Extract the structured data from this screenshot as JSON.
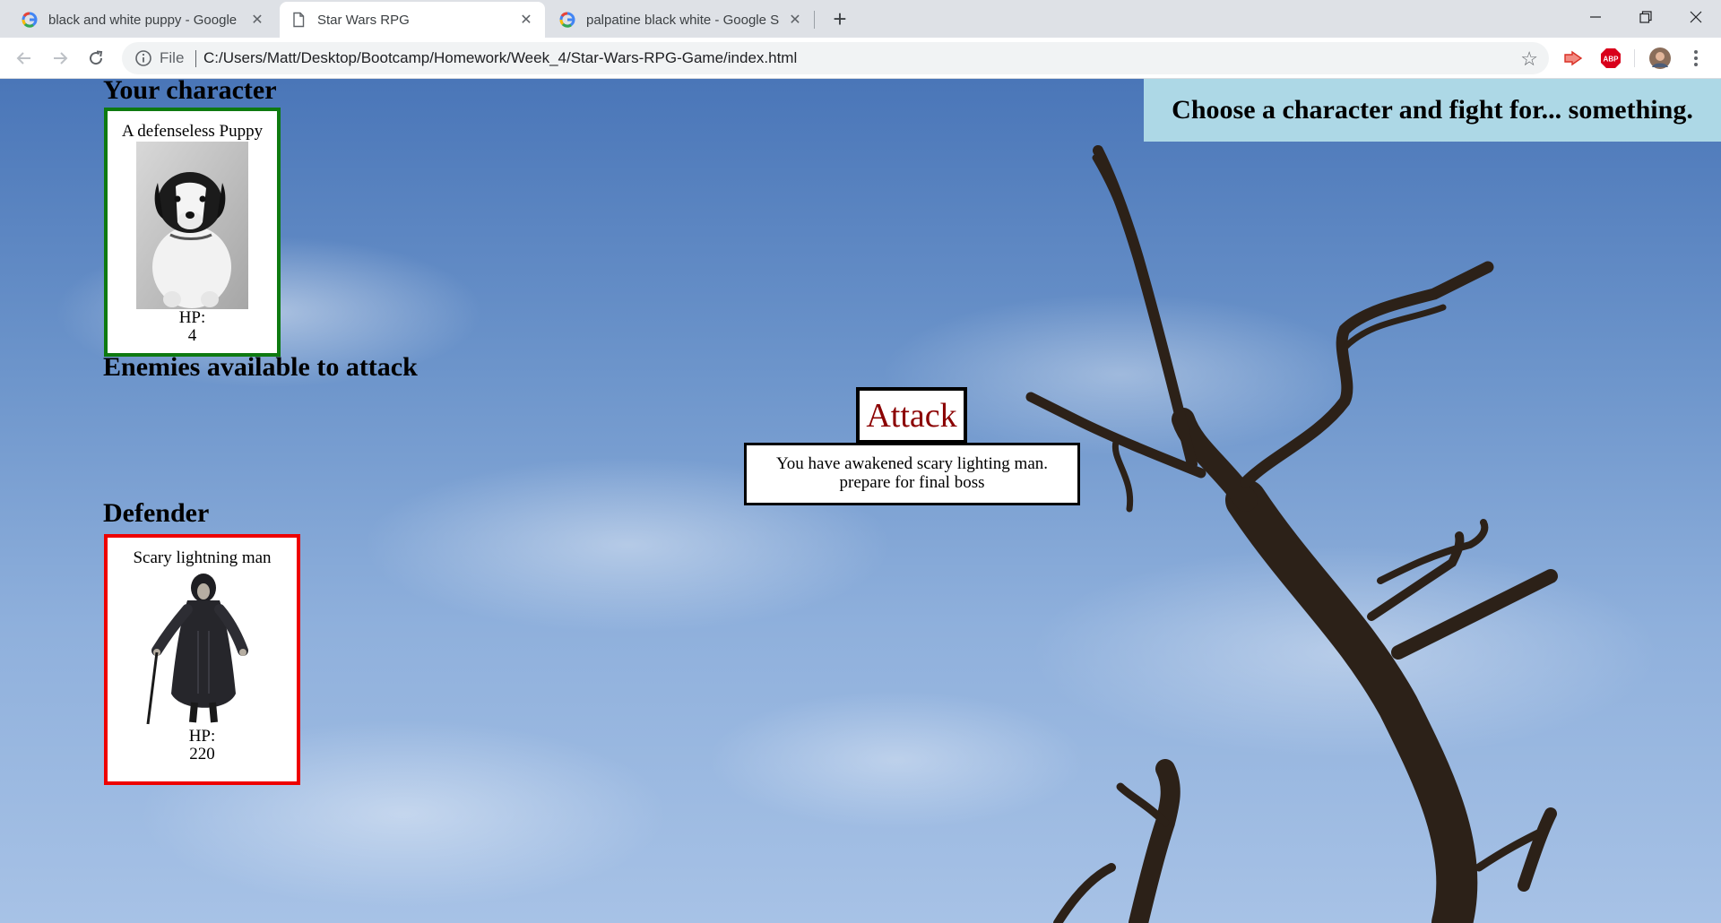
{
  "browser": {
    "tabs": [
      {
        "title": "black and white puppy - Google",
        "favicon": "google-g-icon",
        "active": false
      },
      {
        "title": "Star Wars RPG",
        "favicon": "page-icon",
        "active": true
      },
      {
        "title": "palpatine black white - Google S",
        "favicon": "google-g-icon",
        "active": false
      }
    ],
    "url_scheme": "File",
    "url": "C:/Users/Matt/Desktop/Bootcamp/Homework/Week_4/Star-Wars-RPG-Game/index.html",
    "extensions": [
      "cast-icon",
      "adblock-plus-icon",
      "profile-avatar-icon"
    ],
    "adblock_label": "ABP"
  },
  "page": {
    "banner": "Choose a character and fight for... something.",
    "your_character_heading": "Your character",
    "enemies_heading": "Enemies available to attack",
    "defender_heading": "Defender",
    "player": {
      "name": "A defenseless Puppy",
      "hp_label": "HP:",
      "hp": "4",
      "image": "puppy-photo"
    },
    "defender": {
      "name": "Scary lightning man",
      "hp_label": "HP:",
      "hp": "220",
      "image": "palpatine-figure-photo"
    },
    "attack_label": "Attack",
    "message_line1": "You have awakened scary lighting man.",
    "message_line2": "prepare for final boss"
  }
}
